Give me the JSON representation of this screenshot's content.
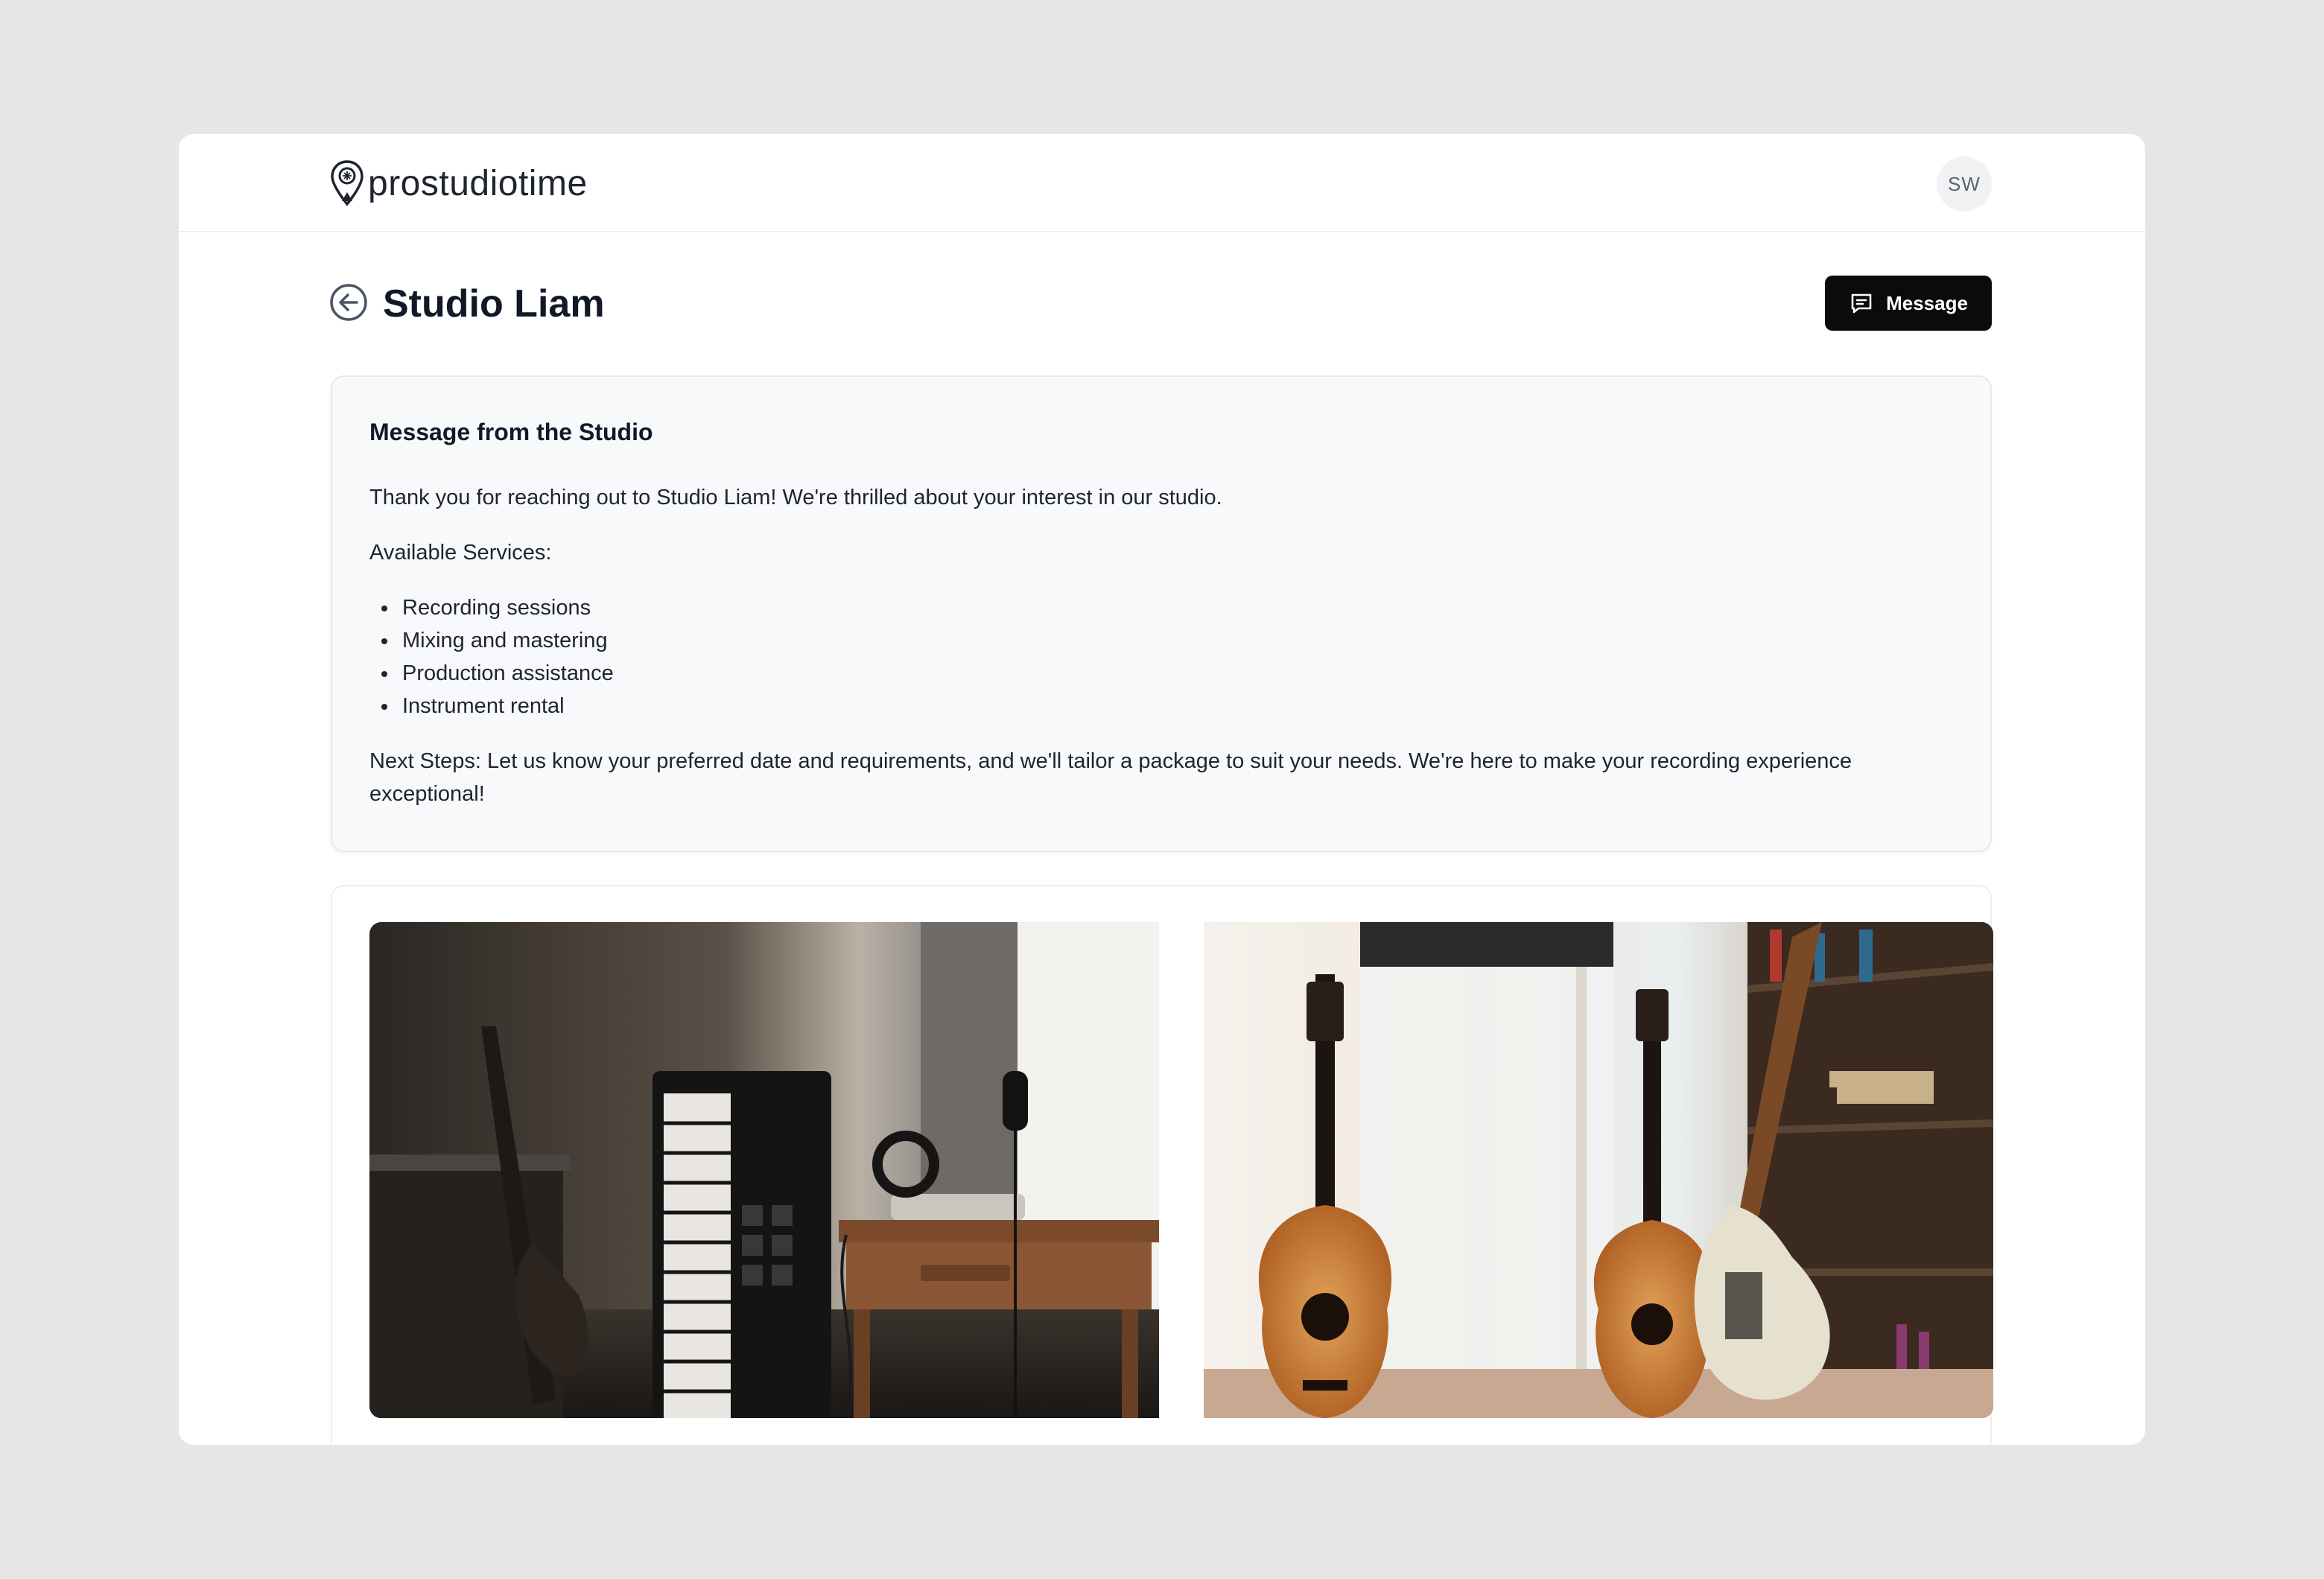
{
  "app": {
    "logo_text": "prostudiotime",
    "avatar_initials": "SW"
  },
  "header": {
    "title": "Studio Liam",
    "message_button_label": "Message"
  },
  "message_card": {
    "heading": "Message from the Studio",
    "intro": "Thank you for reaching out to Studio Liam! We're thrilled about your interest in our studio.",
    "services_label": "Available Services:",
    "services": [
      "Recording sessions",
      "Mixing and mastering",
      "Production assistance",
      "Instrument rental"
    ],
    "next_steps": "Next Steps: Let us know your preferred date and requirements, and we'll tailor a package to suit your needs. We're here to make your recording experience exceptional!"
  },
  "gallery": {
    "photos": [
      {
        "subject": "studio corner with bass guitar, keyboard and microphone"
      },
      {
        "subject": "acoustic and electric guitars by a window and bookshelf"
      }
    ]
  },
  "colors": {
    "page_background": "#e7e6e4",
    "card_background": "#f8f9fb",
    "button_background": "#0b0b0c",
    "text_primary": "#111827"
  },
  "icons": {
    "logo": "map-pin-logo-icon",
    "back": "arrow-left-circle-icon",
    "message": "chat-bubble-icon"
  }
}
